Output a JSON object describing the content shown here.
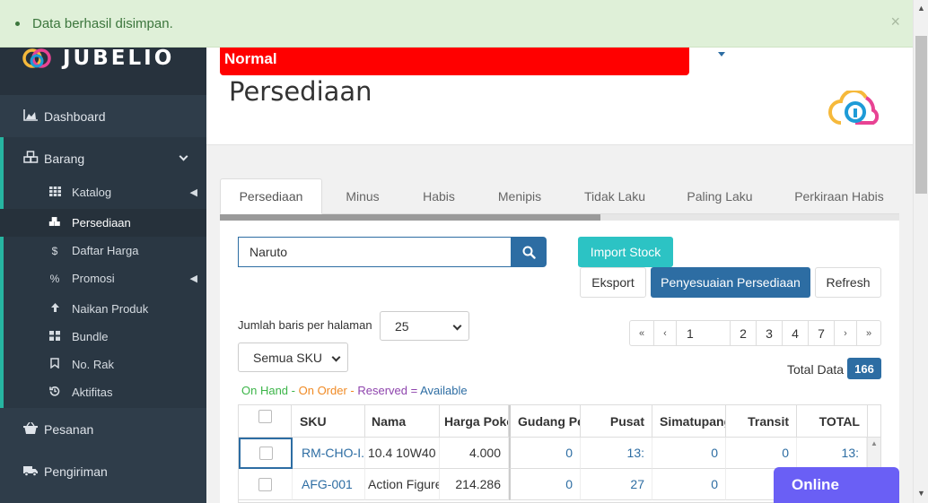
{
  "alert": {
    "message": "Data berhasil disimpan.",
    "close": "×"
  },
  "brand": {
    "name": "JUBELIO"
  },
  "sidebar": {
    "dashboard": "Dashboard",
    "barang": "Barang",
    "sub": [
      "Katalog",
      "Persediaan",
      "Daftar Harga",
      "Promosi",
      "Naikan Produk",
      "Bundle",
      "No. Rak",
      "Aktifitas"
    ],
    "pesanan": "Pesanan",
    "pengiriman": "Pengiriman"
  },
  "header": {
    "mode": "Normal",
    "title": "Persediaan"
  },
  "tabs": [
    "Persediaan",
    "Minus",
    "Habis",
    "Menipis",
    "Tidak Laku",
    "Paling Laku",
    "Perkiraan Habis"
  ],
  "search": {
    "value": "Naruto"
  },
  "buttons": {
    "import_stock": "Import Stock",
    "eksport": "Eksport",
    "penyesuaian": "Penyesuaian Persediaan",
    "refresh": "Refresh"
  },
  "rows_per_page": {
    "label": "Jumlah baris per halaman",
    "value": "25"
  },
  "sku_filter": {
    "value": "Semua SKU"
  },
  "pagination": {
    "first": "«",
    "prev": "‹",
    "current": "1",
    "pages": [
      "2",
      "3",
      "4",
      "7"
    ],
    "next": "›",
    "last": "»"
  },
  "total": {
    "label": "Total Data",
    "value": "166"
  },
  "legend": {
    "on_hand": "On Hand",
    "sep1": " - ",
    "on_order": "On Order",
    "sep2": " - ",
    "reserved": "Reserved",
    "eq": " = ",
    "available": "Available",
    "colors": {
      "on_hand": "#3cb549",
      "on_order": "#f08a24",
      "reserved": "#8e44ad",
      "available": "#2d6da3"
    }
  },
  "table": {
    "columns": [
      "SKU",
      "Nama",
      "Harga Poko",
      "Gudang Pe",
      "Pusat",
      "Simatupang",
      "Transit",
      "TOTAL"
    ],
    "rows": [
      {
        "sku": "RM-CHO-I.",
        "nama": "10.4 10W40",
        "harga": "4.000",
        "gudang": "0",
        "pusat": "13:",
        "simatupang": "0",
        "transit": "0",
        "total": "13:"
      },
      {
        "sku": "AFG-001",
        "nama": "Action Figure",
        "harga": "214.286",
        "gudang": "0",
        "pusat": "27",
        "simatupang": "0",
        "transit": "",
        "total": ""
      }
    ]
  },
  "chat": {
    "label": "Online"
  },
  "colors": {
    "primary": "#2d6da3",
    "teal": "#2cc3c4",
    "sidebar": "#2f3d4a",
    "alert_bg": "#dff0d8",
    "mode_red": "#ff0000",
    "chat": "#6a5ff5"
  }
}
